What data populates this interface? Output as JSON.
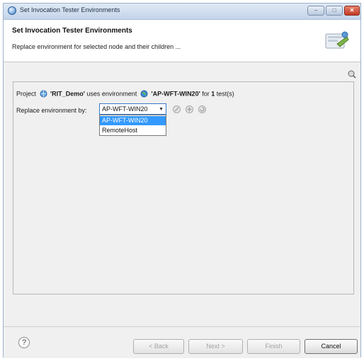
{
  "window": {
    "title": "Set Invocation Tester Environments",
    "controls": {
      "minimize": "–",
      "maximize": "□",
      "close": "✕"
    }
  },
  "header": {
    "title": "Set Invocation Tester Environments",
    "description": "Replace environment for selected node and their children ..."
  },
  "summary": {
    "prefix": "Project",
    "project_name": "'RIT_Demo'",
    "uses_text": "uses environment",
    "environment_name": "'AP-WFT-WIN20'",
    "for_text": "for",
    "count": "1",
    "suffix": "test(s)"
  },
  "replace": {
    "label": "Replace environment by:",
    "selected_value": "AP-WFT-WIN20",
    "options": [
      "AP-WFT-WIN20",
      "RemoteHost"
    ]
  },
  "footer": {
    "help_symbol": "?",
    "back_label": "< Back",
    "next_label": "Next >",
    "finish_label": "Finish",
    "cancel_label": "Cancel"
  },
  "icons": {
    "title": "app-globe-icon",
    "header_graphic": "wizard-banner-icon",
    "toolbar": "view-menu-icon",
    "project": "project-icon",
    "environment": "environment-globe-icon",
    "actions": [
      "edit-environment-icon",
      "add-environment-icon",
      "refresh-environment-icon"
    ]
  },
  "colors": {
    "selection": "#3399ff",
    "titlebar": "#c4d4ea",
    "close_button": "#c03a25"
  }
}
